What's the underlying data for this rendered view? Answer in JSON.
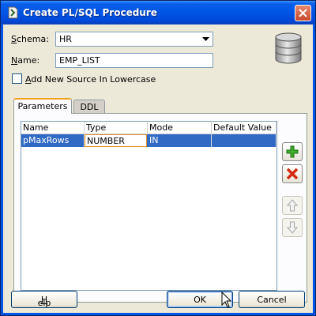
{
  "window": {
    "title": "Create PL/SQL Procedure"
  },
  "form": {
    "schema_label_prefix": "S",
    "schema_label_rest": "chema:",
    "schema_value": "HR",
    "name_label_prefix": "N",
    "name_label_rest": "ame:",
    "name_value": "EMP_LIST",
    "lowercase_label_prefix": "A",
    "lowercase_label_rest": "dd New Source In Lowercase",
    "lowercase_checked": false
  },
  "tabs": [
    {
      "label": "Parameters",
      "active": true
    },
    {
      "label": "DDL",
      "active": false
    }
  ],
  "table": {
    "columns": [
      "Name",
      "Type",
      "Mode",
      "Default Value"
    ],
    "rows": [
      {
        "name": "pMaxRows",
        "type": "NUMBER",
        "mode": "IN",
        "default_value": ""
      }
    ]
  },
  "side_buttons": [
    {
      "icon": "add-icon",
      "enabled": true
    },
    {
      "icon": "remove-icon",
      "enabled": true
    },
    {
      "icon": "move-up-icon",
      "enabled": false
    },
    {
      "icon": "move-down-icon",
      "enabled": false
    }
  ],
  "buttons": {
    "help_prefix": "H",
    "help_rest": "elp",
    "ok": "OK",
    "cancel": "Cancel"
  },
  "colors": {
    "title_bar": "#0054e3",
    "selection": "#316ac5",
    "dialog_bg": "#ece9d8"
  }
}
